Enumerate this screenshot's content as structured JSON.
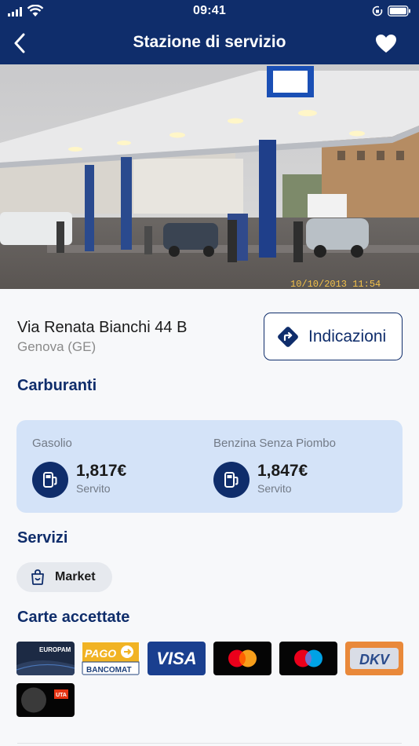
{
  "status_bar": {
    "time": "09:41"
  },
  "header": {
    "title": "Stazione di servizio"
  },
  "station": {
    "address": "Via Renata Bianchi 44 B",
    "city": "Genova (GE)",
    "directions_label": "Indicazioni",
    "photo_timestamp": "10/10/2013 11:54"
  },
  "fuels": {
    "title": "Carburanti",
    "items": [
      {
        "name": "Gasolio",
        "price": "1,817€",
        "mode": "Servito"
      },
      {
        "name": "Benzina Senza Piombo",
        "price": "1,847€",
        "mode": "Servito"
      }
    ]
  },
  "services": {
    "title": "Servizi",
    "items": [
      {
        "label": "Market",
        "icon": "shopping-bag-icon"
      }
    ]
  },
  "cards": {
    "title": "Carte accettate",
    "items": [
      {
        "name": "Europam",
        "text": "EUROPAM"
      },
      {
        "name": "PagoBancomat",
        "text_top": "PAGO",
        "text_bottom": "BANCOMAT"
      },
      {
        "name": "Visa",
        "text": "VISA"
      },
      {
        "name": "Mastercard"
      },
      {
        "name": "Maestro"
      },
      {
        "name": "DKV",
        "text": "DKV"
      },
      {
        "name": "UTA",
        "text": "UTA"
      }
    ]
  },
  "colors": {
    "primary": "#0f2d6b",
    "fuel_card_bg": "#d4e3f8",
    "chip_bg": "#e6e9ee",
    "visa_blue": "#1a3f8f",
    "mastercard_red": "#eb001b",
    "mastercard_orange": "#f79e1b",
    "dkv_orange": "#e9893a"
  }
}
